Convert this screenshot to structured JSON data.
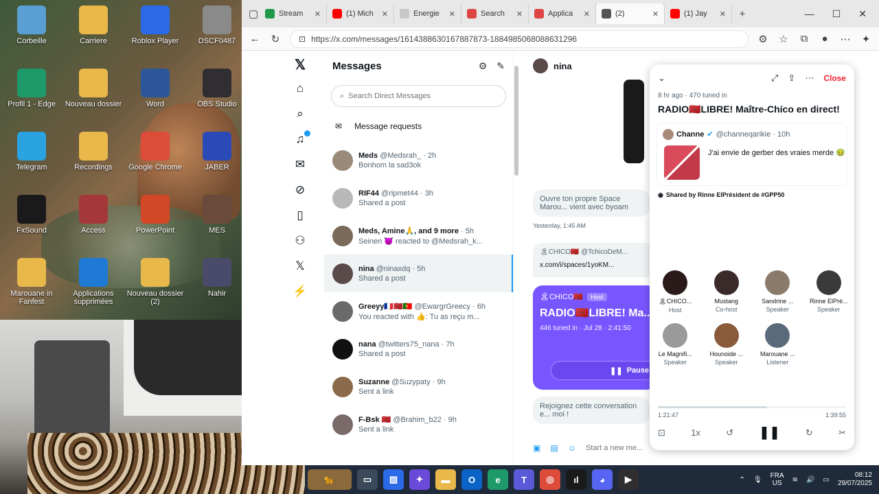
{
  "desktop": {
    "icons": [
      {
        "label": "Corbeille",
        "icon": "recycle-bin-icon",
        "color": "#5a9fd4"
      },
      {
        "label": "Carriere",
        "icon": "folder-icon",
        "color": "#e8b84a"
      },
      {
        "label": "Roblox Player",
        "icon": "roblox-icon",
        "color": "#2a6ae8"
      },
      {
        "label": "DSCF0487",
        "icon": "image-file-icon",
        "color": "#8a8a8a"
      },
      {
        "label": "Profil 1 - Edge",
        "icon": "edge-icon",
        "color": "#1e9a6a"
      },
      {
        "label": "Nouveau dossier",
        "icon": "folder-icon",
        "color": "#e8b84a"
      },
      {
        "label": "Word",
        "icon": "word-icon",
        "color": "#2b579a"
      },
      {
        "label": "OBS Studio",
        "icon": "obs-icon",
        "color": "#302e31"
      },
      {
        "label": "Telegram",
        "icon": "telegram-icon",
        "color": "#2aa3e0"
      },
      {
        "label": "Recordings",
        "icon": "folder-icon",
        "color": "#e8b84a"
      },
      {
        "label": "Google Chrome",
        "icon": "chrome-icon",
        "color": "#dd4b39"
      },
      {
        "label": "JABER",
        "icon": "video-file-icon",
        "color": "#2a4ab8"
      },
      {
        "label": "FxSound",
        "icon": "fxsound-icon",
        "color": "#1a1a1a"
      },
      {
        "label": "Access",
        "icon": "access-icon",
        "color": "#a4373a"
      },
      {
        "label": "PowerPoint",
        "icon": "powerpoint-icon",
        "color": "#d24726"
      },
      {
        "label": "MES",
        "icon": "video-file-icon",
        "color": "#6a4a3a"
      },
      {
        "label": "Marouane in Fanfest",
        "icon": "folder-icon",
        "color": "#e8b84a"
      },
      {
        "label": "Applications supprimées",
        "icon": "edge-icon",
        "color": "#1e7ad4"
      },
      {
        "label": "Nouveau dossier (2)",
        "icon": "folder-icon",
        "color": "#e8b84a"
      },
      {
        "label": "Nahir",
        "icon": "video-file-icon",
        "color": "#4a4a6a"
      }
    ]
  },
  "browser": {
    "tabs": [
      {
        "label": "Stream",
        "fav": "#1e9a4a",
        "icon": "stream-tab-icon"
      },
      {
        "label": "(1) Mich",
        "fav": "#f00",
        "icon": "youtube-icon"
      },
      {
        "label": "Energie",
        "fav": "#c8c8c8",
        "icon": "page-icon"
      },
      {
        "label": "Search",
        "fav": "#d44",
        "icon": "gmail-icon"
      },
      {
        "label": "Applica",
        "fav": "#d44",
        "icon": "gmail-icon"
      },
      {
        "label": "(2)",
        "fav": "#555",
        "icon": "x-tab-icon",
        "active": true
      },
      {
        "label": "(1) Jay",
        "fav": "#f00",
        "icon": "youtube-icon"
      }
    ],
    "url": "https://x.com/messages/1614388630167887873-1884985068088631296"
  },
  "x": {
    "messages_title": "Messages",
    "search_placeholder": "Search Direct Messages",
    "message_requests": "Message requests",
    "conversations": [
      {
        "name": "Meds",
        "handle": "@Medsrah_ · 2h",
        "preview": "Bonhom la sad3ok",
        "avatar": "#9a8a7a"
      },
      {
        "name": "RIF44",
        "handle": "@ripmet44 · 3h",
        "preview": "Shared a post",
        "avatar": "#b8b8b8"
      },
      {
        "name": "Meds, Amine🙏, and 9 more",
        "handle": "· 5h",
        "preview": "Seinen 😈 reacted to @Medsrah_k...",
        "avatar": "#7a6a5a"
      },
      {
        "name": "nina",
        "handle": "@ninaxdq · 5h",
        "preview": "Shared a post",
        "avatar": "#5a4a4a",
        "selected": true
      },
      {
        "name": "Greeyy🇫🇷🇲🇦🇵🇹",
        "handle": "@EwargrGreecy · 6h",
        "preview": "You reacted with 👍: Tu as reçu m...",
        "avatar": "#6a6a6a"
      },
      {
        "name": "nana",
        "handle": "@twitters75_nana · 7h",
        "preview": "Shared a post",
        "avatar": "#111111"
      },
      {
        "name": "Suzanne",
        "handle": "@Suzypaty · 9h",
        "preview": "Sent a link",
        "avatar": "#8a6a4a"
      },
      {
        "name": "F-Bsk 🇲🇦",
        "handle": "@Brahim_b22 · 9h",
        "preview": "Sent a link",
        "avatar": "#7a6a6a"
      }
    ],
    "chat": {
      "name": "nina",
      "bubble1": "Ouvre ton propre Space Marou... vient avec byoam",
      "ts1": "Yesterday, 1:45 AM",
      "sender": "🏝CHICO🇲🇦 @TchicoDeM...",
      "link": "x.com/i/spaces/1yoKM...",
      "card_host": "🏝CHICO🇲🇦",
      "card_host_badge": "Host",
      "card_title": "RADIO🇲🇦LIBRE! Ma... Chíco en direct!",
      "card_info": "446 tuned in · Jul 28 · 2:41:50",
      "card_pause": "Pause",
      "bubble2": "Rejoignez cette conversation e... moi !",
      "compose_placeholder": "Start a new me..."
    },
    "space": {
      "close": "Close",
      "sub": "8 hr ago · 470 tuned in",
      "title": "RADIO🇲🇦LIBRE! Maître-Chíco en direct!",
      "post_name": "Channe",
      "post_handle": "@channeqarikie · 10h",
      "post_text": "J'ai envie de gerber des vraies merde 🤢",
      "shared_by": "Shared by Rinne ElPrésident de #GPP50",
      "speakers": [
        {
          "name": "🏝CHICO...",
          "role": "Host",
          "avatar": "#2a1a1a"
        },
        {
          "name": "Mustang",
          "role": "Co-host",
          "avatar": "#3a2a2a"
        },
        {
          "name": "Sandrine ...",
          "role": "Speaker",
          "avatar": "#8a7a6a"
        },
        {
          "name": "Rinne ElPré...",
          "role": "Speaker",
          "avatar": "#3a3a3a"
        },
        {
          "name": "Le Magnifi...",
          "role": "Speaker",
          "avatar": "#9a9a9a"
        },
        {
          "name": "Hounoide ...",
          "role": "Speaker",
          "avatar": "#8a5a3a"
        },
        {
          "name": "Marouane ...",
          "role": "Listener",
          "avatar": "#5a6a7a"
        }
      ],
      "elapsed": "1:21:47",
      "total": "1:39:55",
      "progress": 0.58,
      "speed": "1x"
    }
  },
  "taskbar": {
    "lang1": "FRA",
    "lang2": "US",
    "time": "08:12",
    "date": "29/07/2025"
  }
}
